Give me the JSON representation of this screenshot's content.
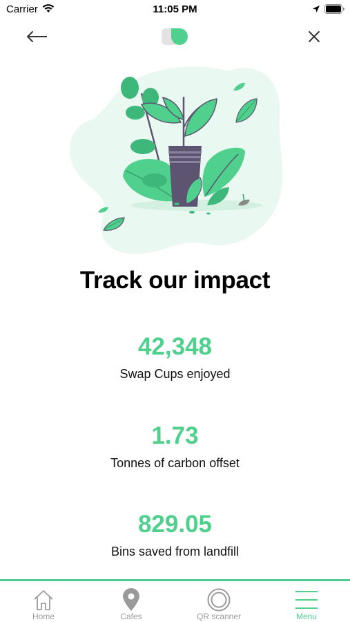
{
  "status_bar": {
    "carrier": "Carrier",
    "time": "11:05 PM"
  },
  "nav": {
    "back_icon": "arrow-left-icon",
    "logo_icon": "swap-cup-logo-icon",
    "close_icon": "close-icon"
  },
  "illustration": {
    "description_icon": "plant-in-cup-illustration"
  },
  "title": "Track our impact",
  "stats": [
    {
      "value": "42,348",
      "label": "Swap Cups enjoyed"
    },
    {
      "value": "1.73",
      "label": "Tonnes of carbon offset"
    },
    {
      "value": "829.05",
      "label": "Bins saved from landfill"
    }
  ],
  "tabs": [
    {
      "label": "Home",
      "icon": "home-icon",
      "active": false
    },
    {
      "label": "Cafes",
      "icon": "map-pin-icon",
      "active": false
    },
    {
      "label": "QR scanner",
      "icon": "qr-scanner-icon",
      "active": false
    },
    {
      "label": "Menu",
      "icon": "menu-icon",
      "active": true
    }
  ],
  "colors": {
    "accent": "#4fd08d",
    "inactive": "#9a9a9a",
    "illustration_bg": "#e9f8f0",
    "cup": "#5c5470"
  }
}
